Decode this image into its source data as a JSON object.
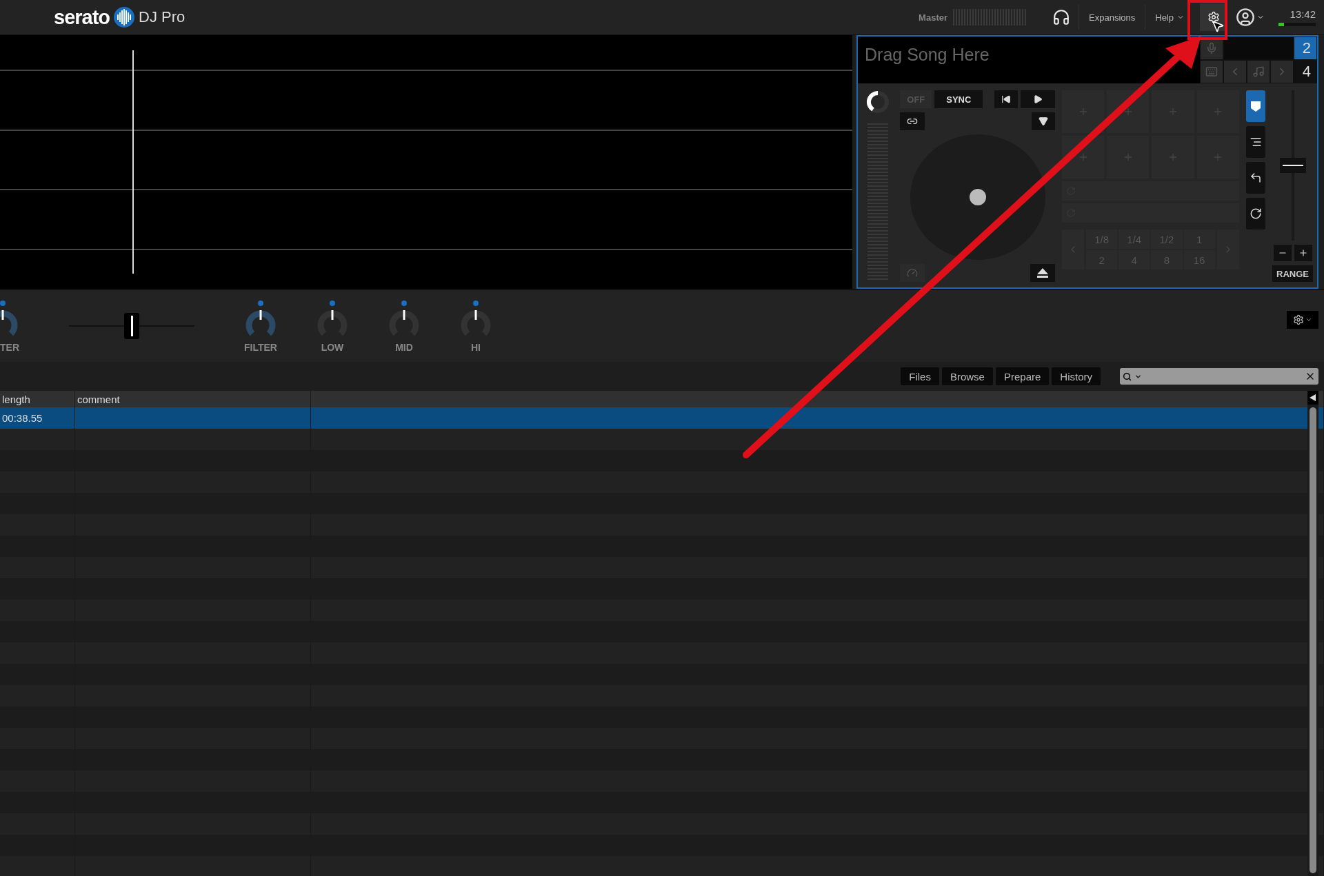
{
  "top_bar": {
    "brand": "serato",
    "product": "DJ Pro",
    "master_label": "Master",
    "expansions": "Expansions",
    "help": "Help",
    "clock": "13:42"
  },
  "deck": {
    "song_placeholder": "Drag Song Here",
    "deck_numbers": [
      {
        "label": "2",
        "selected": true
      },
      {
        "label": "4",
        "selected": false
      }
    ],
    "keylock": "OFF",
    "sync": "SYNC",
    "loop_values": [
      "1/8",
      "1/4",
      "1/2",
      "1",
      "2",
      "4",
      "8",
      "16"
    ],
    "modes": [
      {
        "kind": "cue",
        "selected": true
      },
      {
        "kind": "roll",
        "selected": false
      },
      {
        "kind": "loop",
        "selected": false
      },
      {
        "kind": "sync",
        "selected": false
      }
    ],
    "pitch": {
      "level": 0.5
    },
    "range": "RANGE"
  },
  "mixer": {
    "crossfader": {
      "level": 0.5
    },
    "knobs": [
      {
        "label": "TER",
        "active": true
      },
      {
        "label": "FILTER",
        "active": true
      },
      {
        "label": "LOW",
        "active": false
      },
      {
        "label": "MID",
        "active": false
      },
      {
        "label": "HI",
        "active": false
      }
    ]
  },
  "library": {
    "tabs": [
      "Files",
      "Browse",
      "Prepare",
      "History"
    ],
    "columns": [
      "length",
      "comment"
    ],
    "rows": [
      {
        "cells": [
          "00:38.55"
        ],
        "selected": true
      }
    ]
  }
}
